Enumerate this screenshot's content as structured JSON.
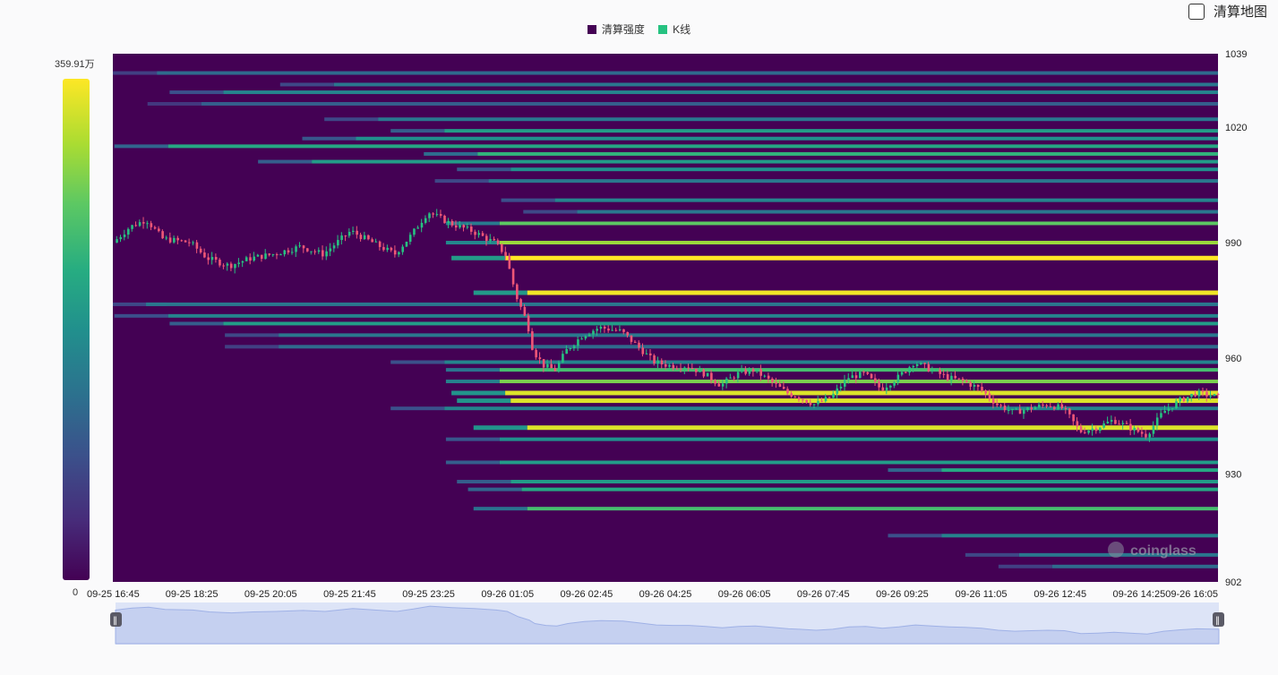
{
  "legend": {
    "heat": "清算强度",
    "kline": "K线",
    "heat_color": "#440154",
    "kline_color": "#26c281"
  },
  "toggle": {
    "label": "清算地图",
    "checked": false
  },
  "colorbar": {
    "max_label": "359.91万",
    "min_label": "0"
  },
  "watermark": "coinglass",
  "chart_data": {
    "type": "heatmap",
    "x_ticks": [
      "09-25 16:45",
      "09-25 18:25",
      "09-25 20:05",
      "09-25 21:45",
      "09-25 23:25",
      "09-26 01:05",
      "09-26 02:45",
      "09-26 04:25",
      "09-26 06:05",
      "09-26 07:45",
      "09-26 09:25",
      "09-26 11:05",
      "09-26 12:45",
      "09-26 14:25",
      "09-26 16:05"
    ],
    "y_ticks": [
      1039,
      1020,
      990,
      960,
      930,
      902
    ],
    "ylim": [
      902,
      1039
    ],
    "series": [
      "清算强度",
      "K线"
    ],
    "liquidation_levels": [
      {
        "price": 1034,
        "start": 0.04,
        "intensity": 0.35
      },
      {
        "price": 1031,
        "start": 0.2,
        "intensity": 0.4
      },
      {
        "price": 1029,
        "start": 0.1,
        "intensity": 0.45
      },
      {
        "price": 1026,
        "start": 0.08,
        "intensity": 0.3
      },
      {
        "price": 1022,
        "start": 0.24,
        "intensity": 0.4
      },
      {
        "price": 1019,
        "start": 0.3,
        "intensity": 0.55
      },
      {
        "price": 1017,
        "start": 0.22,
        "intensity": 0.5
      },
      {
        "price": 1015,
        "start": 0.05,
        "intensity": 0.6
      },
      {
        "price": 1013,
        "start": 0.33,
        "intensity": 0.65
      },
      {
        "price": 1011,
        "start": 0.18,
        "intensity": 0.55
      },
      {
        "price": 1009,
        "start": 0.36,
        "intensity": 0.5
      },
      {
        "price": 1006,
        "start": 0.34,
        "intensity": 0.4
      },
      {
        "price": 1001,
        "start": 0.4,
        "intensity": 0.45
      },
      {
        "price": 998,
        "start": 0.42,
        "intensity": 0.4
      },
      {
        "price": 995,
        "start": 0.35,
        "intensity": 0.75
      },
      {
        "price": 990,
        "start": 0.35,
        "intensity": 0.85
      },
      {
        "price": 986,
        "start": 0.355,
        "intensity": 1.0
      },
      {
        "price": 977,
        "start": 0.375,
        "intensity": 0.98
      },
      {
        "price": 974,
        "start": 0.03,
        "intensity": 0.4
      },
      {
        "price": 971,
        "start": 0.05,
        "intensity": 0.45
      },
      {
        "price": 969,
        "start": 0.1,
        "intensity": 0.55
      },
      {
        "price": 966,
        "start": 0.15,
        "intensity": 0.4
      },
      {
        "price": 963,
        "start": 0.15,
        "intensity": 0.35
      },
      {
        "price": 959,
        "start": 0.3,
        "intensity": 0.45
      },
      {
        "price": 957,
        "start": 0.35,
        "intensity": 0.7
      },
      {
        "price": 954,
        "start": 0.35,
        "intensity": 0.8
      },
      {
        "price": 951,
        "start": 0.355,
        "intensity": 0.95
      },
      {
        "price": 949,
        "start": 0.36,
        "intensity": 0.95
      },
      {
        "price": 947,
        "start": 0.3,
        "intensity": 0.45
      },
      {
        "price": 942,
        "start": 0.375,
        "intensity": 0.95
      },
      {
        "price": 939,
        "start": 0.35,
        "intensity": 0.5
      },
      {
        "price": 933,
        "start": 0.35,
        "intensity": 0.55
      },
      {
        "price": 931,
        "start": 0.75,
        "intensity": 0.6
      },
      {
        "price": 928,
        "start": 0.36,
        "intensity": 0.55
      },
      {
        "price": 926,
        "start": 0.37,
        "intensity": 0.6
      },
      {
        "price": 921,
        "start": 0.375,
        "intensity": 0.7
      },
      {
        "price": 914,
        "start": 0.75,
        "intensity": 0.45
      },
      {
        "price": 909,
        "start": 0.82,
        "intensity": 0.4
      },
      {
        "price": 906,
        "start": 0.85,
        "intensity": 0.35
      }
    ],
    "close_path": [
      {
        "t": 0.0,
        "p": 990
      },
      {
        "t": 0.015,
        "p": 994
      },
      {
        "t": 0.03,
        "p": 996
      },
      {
        "t": 0.045,
        "p": 991
      },
      {
        "t": 0.07,
        "p": 990
      },
      {
        "t": 0.085,
        "p": 986
      },
      {
        "t": 0.105,
        "p": 984
      },
      {
        "t": 0.125,
        "p": 986
      },
      {
        "t": 0.145,
        "p": 987
      },
      {
        "t": 0.17,
        "p": 989
      },
      {
        "t": 0.19,
        "p": 987
      },
      {
        "t": 0.215,
        "p": 993
      },
      {
        "t": 0.235,
        "p": 990
      },
      {
        "t": 0.255,
        "p": 987
      },
      {
        "t": 0.27,
        "p": 992
      },
      {
        "t": 0.285,
        "p": 998
      },
      {
        "t": 0.305,
        "p": 995
      },
      {
        "t": 0.325,
        "p": 993
      },
      {
        "t": 0.345,
        "p": 990
      },
      {
        "t": 0.355,
        "p": 987
      },
      {
        "t": 0.365,
        "p": 976
      },
      {
        "t": 0.375,
        "p": 969
      },
      {
        "t": 0.38,
        "p": 962
      },
      {
        "t": 0.39,
        "p": 958
      },
      {
        "t": 0.4,
        "p": 957
      },
      {
        "t": 0.41,
        "p": 962
      },
      {
        "t": 0.425,
        "p": 966
      },
      {
        "t": 0.44,
        "p": 968
      },
      {
        "t": 0.46,
        "p": 967
      },
      {
        "t": 0.475,
        "p": 963
      },
      {
        "t": 0.49,
        "p": 959
      },
      {
        "t": 0.505,
        "p": 958
      },
      {
        "t": 0.52,
        "p": 958
      },
      {
        "t": 0.535,
        "p": 956
      },
      {
        "t": 0.55,
        "p": 953
      },
      {
        "t": 0.565,
        "p": 956
      },
      {
        "t": 0.58,
        "p": 957
      },
      {
        "t": 0.595,
        "p": 954
      },
      {
        "t": 0.61,
        "p": 951
      },
      {
        "t": 0.62,
        "p": 950
      },
      {
        "t": 0.635,
        "p": 948
      },
      {
        "t": 0.65,
        "p": 950
      },
      {
        "t": 0.665,
        "p": 955
      },
      {
        "t": 0.68,
        "p": 956
      },
      {
        "t": 0.695,
        "p": 952
      },
      {
        "t": 0.71,
        "p": 955
      },
      {
        "t": 0.725,
        "p": 959
      },
      {
        "t": 0.74,
        "p": 957
      },
      {
        "t": 0.755,
        "p": 955
      },
      {
        "t": 0.77,
        "p": 954
      },
      {
        "t": 0.785,
        "p": 952
      },
      {
        "t": 0.8,
        "p": 948
      },
      {
        "t": 0.815,
        "p": 946
      },
      {
        "t": 0.83,
        "p": 947
      },
      {
        "t": 0.845,
        "p": 948
      },
      {
        "t": 0.86,
        "p": 947
      },
      {
        "t": 0.875,
        "p": 941
      },
      {
        "t": 0.89,
        "p": 942
      },
      {
        "t": 0.905,
        "p": 944
      },
      {
        "t": 0.92,
        "p": 942
      },
      {
        "t": 0.935,
        "p": 940
      },
      {
        "t": 0.95,
        "p": 946
      },
      {
        "t": 0.965,
        "p": 949
      },
      {
        "t": 0.98,
        "p": 951
      },
      {
        "t": 1.0,
        "p": 950
      }
    ]
  }
}
